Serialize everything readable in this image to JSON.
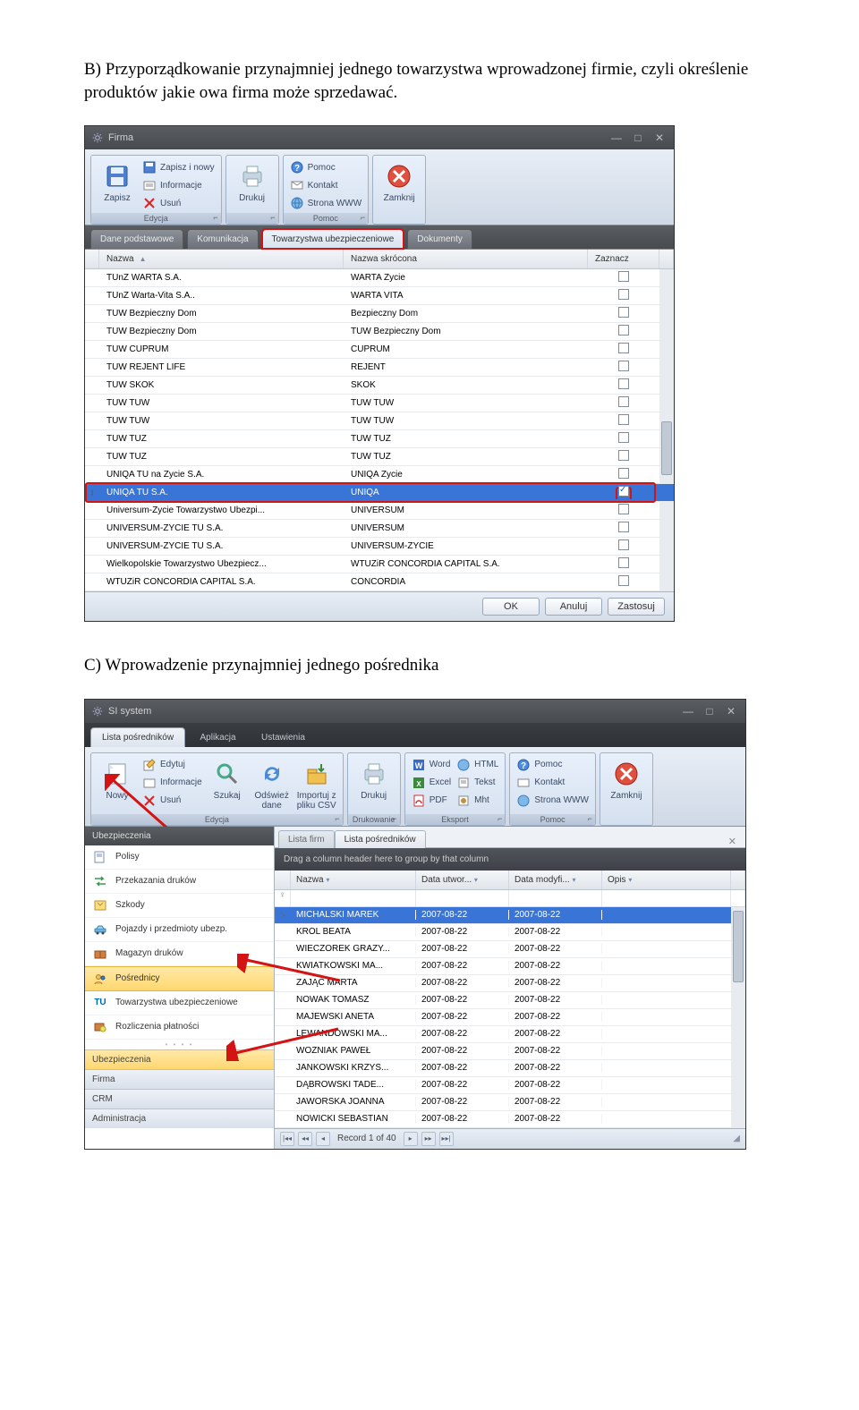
{
  "sectionB": "B) Przyporządkowanie przynajmniej jednego towarzystwa wprowadzonej firmie, czyli określenie produktów jakie owa firma może sprzedawać.",
  "sectionC": "C) Wprowadzenie przynajmniej jednego pośrednika",
  "firmaWindow": {
    "title": "Firma",
    "ribbon": {
      "group_edycja": "Edycja",
      "group_pomoc": "Pomoc",
      "zapisz": "Zapisz",
      "zapisz_nowy": "Zapisz i nowy",
      "informacje": "Informacje",
      "usun": "Usuń",
      "drukuj": "Drukuj",
      "pomoc": "Pomoc",
      "kontakt": "Kontakt",
      "strona_www": "Strona WWW",
      "zamknij": "Zamknij"
    },
    "tabs": {
      "dane": "Dane podstawowe",
      "komunikacja": "Komunikacja",
      "tow": "Towarzystwa ubezpieczeniowe",
      "dok": "Dokumenty"
    },
    "cols": {
      "nazwa": "Nazwa",
      "skrocona": "Nazwa skrócona",
      "zaznacz": "Zaznacz"
    },
    "rows": [
      {
        "n": "TUnŻ WARTA S.A.",
        "s": "WARTA Życie",
        "c": false
      },
      {
        "n": "TUnŻ Warta-Vita S.A..",
        "s": "WARTA VITA",
        "c": false
      },
      {
        "n": "TUW Bezpieczny Dom",
        "s": "Bezpieczny Dom",
        "c": false
      },
      {
        "n": "TUW Bezpieczny Dom",
        "s": "TUW Bezpieczny Dom",
        "c": false
      },
      {
        "n": "TUW CUPRUM",
        "s": "CUPRUM",
        "c": false
      },
      {
        "n": "TUW REJENT LIFE",
        "s": "REJENT",
        "c": false
      },
      {
        "n": "TUW SKOK",
        "s": "SKOK",
        "c": false
      },
      {
        "n": "TUW TUW",
        "s": "TUW TUW",
        "c": false
      },
      {
        "n": "TUW TUW",
        "s": "TUW TUW",
        "c": false
      },
      {
        "n": "TUW TUZ",
        "s": "TUW TUZ",
        "c": false
      },
      {
        "n": "TUW TUZ",
        "s": "TUW TUZ",
        "c": false
      },
      {
        "n": "UNIQA TU na Życie S.A.",
        "s": "UNIQA Życie",
        "c": false
      },
      {
        "n": "UNIQA TU S.A.",
        "s": "UNIQA",
        "c": true,
        "sel": true
      },
      {
        "n": "Universum-Życie Towarzystwo Ubezpi...",
        "s": "UNIVERSUM",
        "c": false
      },
      {
        "n": "UNIVERSUM-ŻYCIE TU S.A.",
        "s": "UNIVERSUM",
        "c": false
      },
      {
        "n": "UNIVERSUM-ŻYCIE TU S.A.",
        "s": "UNIVERSUM-ŻYCIE",
        "c": false
      },
      {
        "n": "Wielkopolskie Towarzystwo Ubezpiecz...",
        "s": "WTUŻiR CONCORDIA CAPITAL S.A.",
        "c": false
      },
      {
        "n": "WTUŻiR CONCORDIA CAPITAL S.A.",
        "s": "CONCORDIA",
        "c": false
      }
    ],
    "buttons": {
      "ok": "OK",
      "anuluj": "Anuluj",
      "zastosuj": "Zastosuj"
    }
  },
  "siWindow": {
    "title": "SI system",
    "topTabs": {
      "lista": "Lista pośredników",
      "app": "Aplikacja",
      "ust": "Ustawienia"
    },
    "ribbon": {
      "nowy": "Nowy",
      "edytuj": "Edytuj",
      "informacje": "Informacje",
      "usun": "Usuń",
      "szukaj": "Szukaj",
      "odswiez": "Odśwież dane",
      "importuj": "Importuj z pliku CSV",
      "drukuj": "Drukuj",
      "word": "Word",
      "html": "HTML",
      "excel": "Excel",
      "tekst": "Tekst",
      "pdf": "PDF",
      "mht": "Mht",
      "pomoc": "Pomoc",
      "kontakt": "Kontakt",
      "www": "Strona WWW",
      "zamknij": "Zamknij",
      "group_edycja": "Edycja",
      "group_druk": "Drukowanie",
      "group_eksport": "Eksport",
      "group_pomoc": "Pomoc"
    },
    "sidebarHeader": "Ubezpieczenia",
    "sidebar": {
      "polisy": "Polisy",
      "przekazania": "Przekazania druków",
      "szkody": "Szkody",
      "pojazdy": "Pojazdy i przedmioty ubezp.",
      "magazyn": "Magazyn druków",
      "posrednicy": "Pośrednicy",
      "tow": "Towarzystwa ubezpieczeniowe",
      "rozliczenia": "Rozliczenia płatności"
    },
    "sidebarFooter": {
      "ubez": "Ubezpieczenia",
      "firma": "Firma",
      "crm": "CRM",
      "admin": "Administracja"
    },
    "subTabs": {
      "firm": "Lista firm",
      "pos": "Lista pośredników"
    },
    "groupHint": "Drag a column header here to group by that column",
    "cols": {
      "nazwa": "Nazwa",
      "utw": "Data utwor...",
      "mod": "Data modyfi...",
      "opis": "Opis"
    },
    "rows": [
      {
        "n": "MICHALSKI MAREK",
        "u": "2007-08-22",
        "m": "2007-08-22",
        "sel": true
      },
      {
        "n": "KRÓL BEATA",
        "u": "2007-08-22",
        "m": "2007-08-22"
      },
      {
        "n": "WIECZOREK GRAŻY...",
        "u": "2007-08-22",
        "m": "2007-08-22"
      },
      {
        "n": "KWIATKOWSKI MA...",
        "u": "2007-08-22",
        "m": "2007-08-22"
      },
      {
        "n": "ZAJĄC MARTA",
        "u": "2007-08-22",
        "m": "2007-08-22"
      },
      {
        "n": "NOWAK TOMASZ",
        "u": "2007-08-22",
        "m": "2007-08-22"
      },
      {
        "n": "MAJEWSKI ANETA",
        "u": "2007-08-22",
        "m": "2007-08-22"
      },
      {
        "n": "LEWANDOWSKI MA...",
        "u": "2007-08-22",
        "m": "2007-08-22"
      },
      {
        "n": "WOŹNIAK PAWEŁ",
        "u": "2007-08-22",
        "m": "2007-08-22"
      },
      {
        "n": "JANKOWSKI KRZYS...",
        "u": "2007-08-22",
        "m": "2007-08-22"
      },
      {
        "n": "DĄBROWSKI TADE...",
        "u": "2007-08-22",
        "m": "2007-08-22"
      },
      {
        "n": "JAWORSKA JOANNA",
        "u": "2007-08-22",
        "m": "2007-08-22"
      },
      {
        "n": "NOWICKI SEBASTIAN",
        "u": "2007-08-22",
        "m": "2007-08-22"
      }
    ],
    "recordLabel": "Record 1 of 40"
  }
}
